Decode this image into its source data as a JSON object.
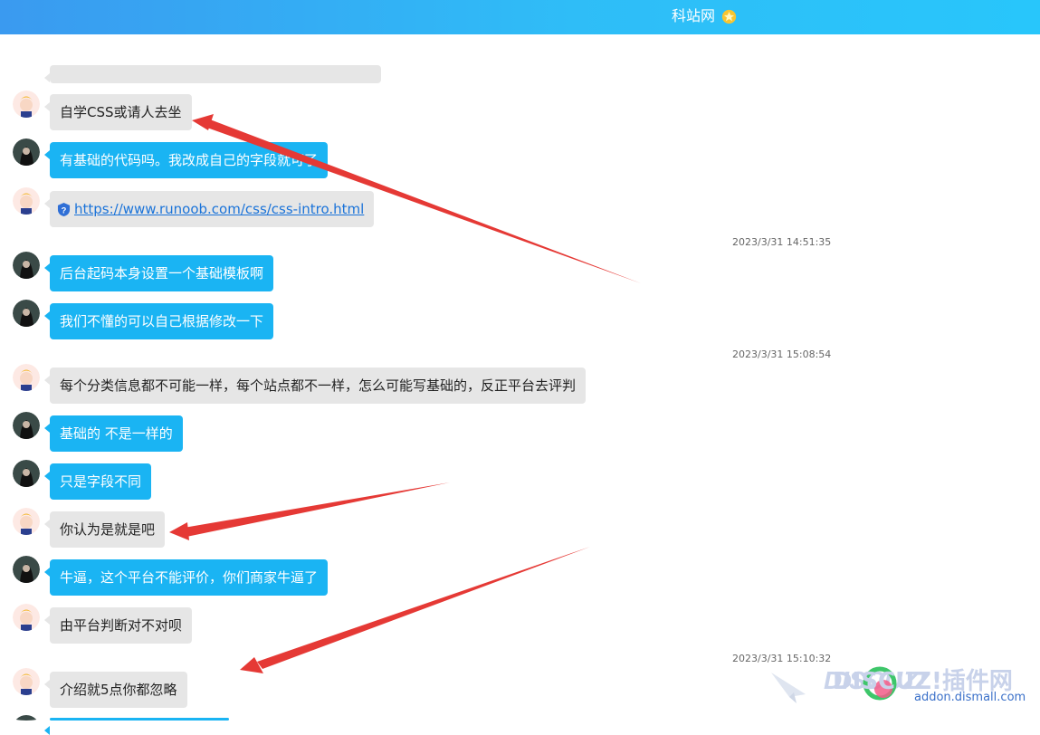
{
  "header": {
    "title": "科站网"
  },
  "messages": [
    {
      "side": "them",
      "text": "自学CSS或请人去坐"
    },
    {
      "side": "me",
      "text": "有基础的代码吗。我改成自己的字段就可了"
    },
    {
      "side": "them",
      "link": "https://www.runoob.com/css/css-intro.html"
    },
    {
      "timestamp": "2023/3/31 14:51:35"
    },
    {
      "side": "me",
      "text": "后台起码本身设置一个基础模板啊"
    },
    {
      "side": "me",
      "text": "我们不懂的可以自己根据修改一下"
    },
    {
      "timestamp": "2023/3/31 15:08:54"
    },
    {
      "side": "them",
      "text": "每个分类信息都不可能一样，每个站点都不一样，怎么可能写基础的，反正平台去评判"
    },
    {
      "side": "me",
      "text": "基础的 不是一样的"
    },
    {
      "side": "me",
      "text": "只是字段不同"
    },
    {
      "side": "them",
      "text": "你认为是就是吧"
    },
    {
      "side": "me",
      "text": "牛逼，这个平台不能评价，你们商家牛逼了"
    },
    {
      "side": "them",
      "text": "由平台判断对不对呗"
    },
    {
      "timestamp": "2023/3/31 15:10:32"
    },
    {
      "side": "them",
      "text": "介绍就5点你都忽略"
    }
  ],
  "watermark": {
    "brand": "DISCUZ!插件网",
    "url": "addon.dismall.com"
  },
  "colors": {
    "header_start": "#3a9af0",
    "header_end": "#28c6fb",
    "bubble_me": "#1ab4f3",
    "bubble_them": "#e6e6e6",
    "arrow": "#e53935"
  }
}
